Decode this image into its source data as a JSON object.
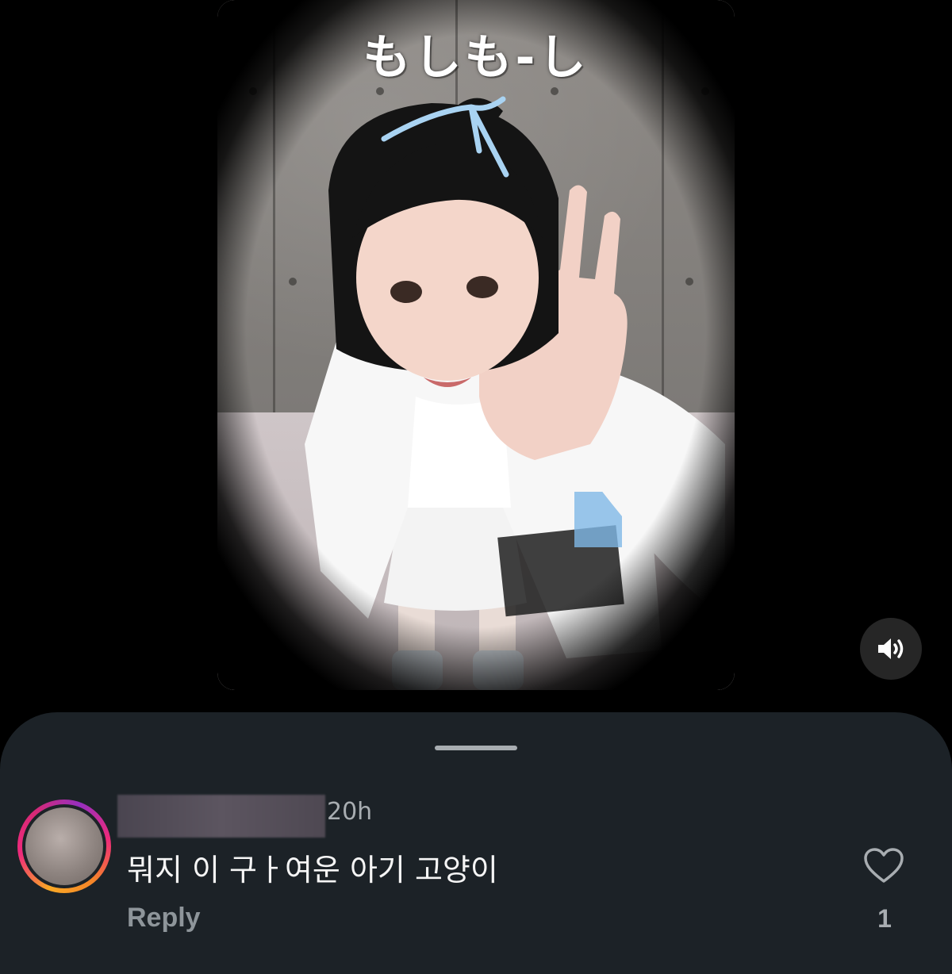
{
  "video": {
    "caption": "もしも-し",
    "sound_icon": "speaker-volume-icon"
  },
  "comments_sheet": {
    "grabber_icon": "drag-handle-icon",
    "comment": {
      "avatar_icon": "user-avatar-blurred",
      "username": "",
      "timestamp": "20h",
      "text": "뭐지 이 구ㅏ여운 아기 고양이",
      "reply_label": "Reply",
      "like_icon": "heart-outline-icon",
      "like_count": "1"
    }
  },
  "colors": {
    "background": "#000000",
    "sheet_background": "#1c2227",
    "primary_text": "#f5f5f5",
    "secondary_text": "#a8adb1",
    "reply_text": "#8e959a"
  }
}
